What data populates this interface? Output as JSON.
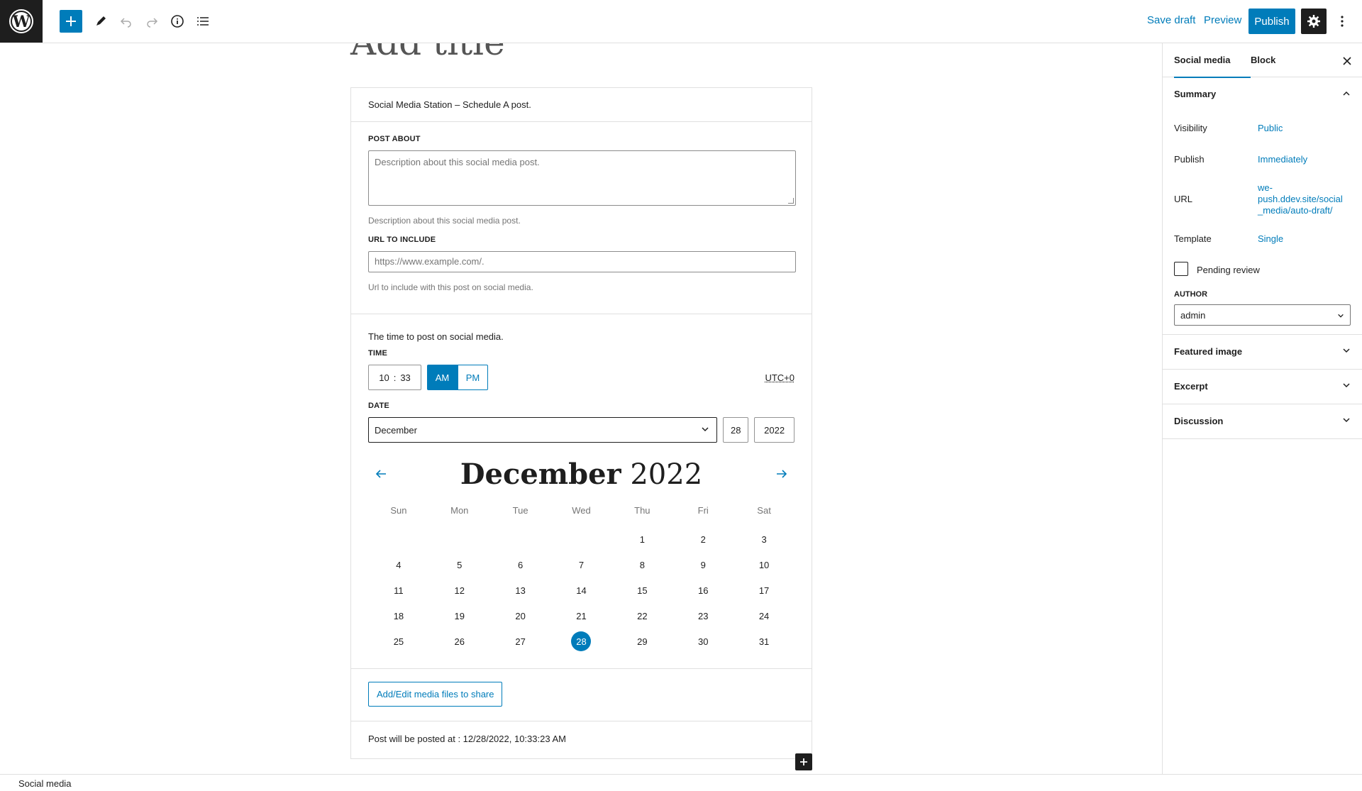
{
  "topbar": {
    "save_draft": "Save draft",
    "preview": "Preview",
    "publish": "Publish"
  },
  "editor": {
    "title_placeholder": "Add title",
    "block_heading": "Social Media Station – Schedule A post.",
    "post_about": {
      "label": "POST ABOUT",
      "placeholder": "Description about this social media post.",
      "help": "Description about this social media post."
    },
    "url": {
      "label": "URL TO INCLUDE",
      "placeholder": "https://www.example.com/.",
      "help": "Url to include with this post on social media."
    },
    "schedule": {
      "intro": "The time to post on social media.",
      "time_label": "TIME",
      "hour": "10",
      "separator": ":",
      "minute": "33",
      "am": "AM",
      "pm": "PM",
      "timezone": "UTC+0",
      "date_label": "DATE",
      "month": "December",
      "day": "28",
      "year": "2022"
    },
    "calendar": {
      "month_name": "December",
      "year": "2022",
      "weekdays": [
        "Sun",
        "Mon",
        "Tue",
        "Wed",
        "Thu",
        "Fri",
        "Sat"
      ],
      "leading_blanks": 4,
      "days_in_month": 31,
      "selected_day": 28
    },
    "media_button": "Add/Edit media files to share",
    "posted_at": "Post will be posted at : 12/28/2022, 10:33:23 AM"
  },
  "sidebar": {
    "tab_social": "Social media",
    "tab_block": "Block",
    "summary": "Summary",
    "visibility_label": "Visibility",
    "visibility_value": "Public",
    "publish_label": "Publish",
    "publish_value": "Immediately",
    "url_label": "URL",
    "url_value_1": "we-",
    "url_value_2": "push.ddev.site/social",
    "url_value_3": "_media/auto-draft/",
    "template_label": "Template",
    "template_value": "Single",
    "pending_review": "Pending review",
    "author_label": "AUTHOR",
    "author_value": "admin",
    "featured_image": "Featured image",
    "excerpt": "Excerpt",
    "discussion": "Discussion"
  },
  "statusbar": {
    "breadcrumb": "Social media"
  },
  "colors": {
    "accent": "#007cba",
    "dark": "#1e1e1e",
    "border": "#e0e0e0"
  }
}
